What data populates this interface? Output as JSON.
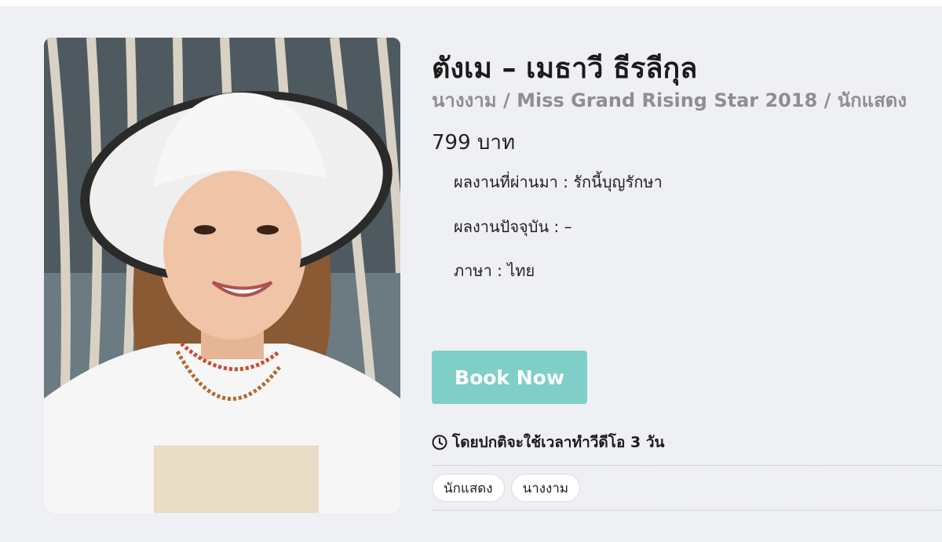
{
  "profile": {
    "name": "ตังเม – เมธาวี ธีรลีกุล",
    "subtitle": "นางงาม / Miss Grand Rising Star 2018 / นักแสดง",
    "price": "799 บาท",
    "details": [
      "ผลงานที่ผ่านมา : รักนี้บุญรักษา",
      "ผลงานปัจจุบัน : –",
      "ภาษา : ไทย"
    ],
    "book_label": "Book Now",
    "duration_text": "โดยปกติจะใช้เวลาทำวีดีโอ 3 วัน",
    "duration_icon": "clock-icon",
    "tags": [
      "นักแสดง",
      "นางงาม"
    ]
  },
  "colors": {
    "background": "#eff0f4",
    "accent": "#7fcfc8",
    "subtitle": "#8f8f8f"
  }
}
